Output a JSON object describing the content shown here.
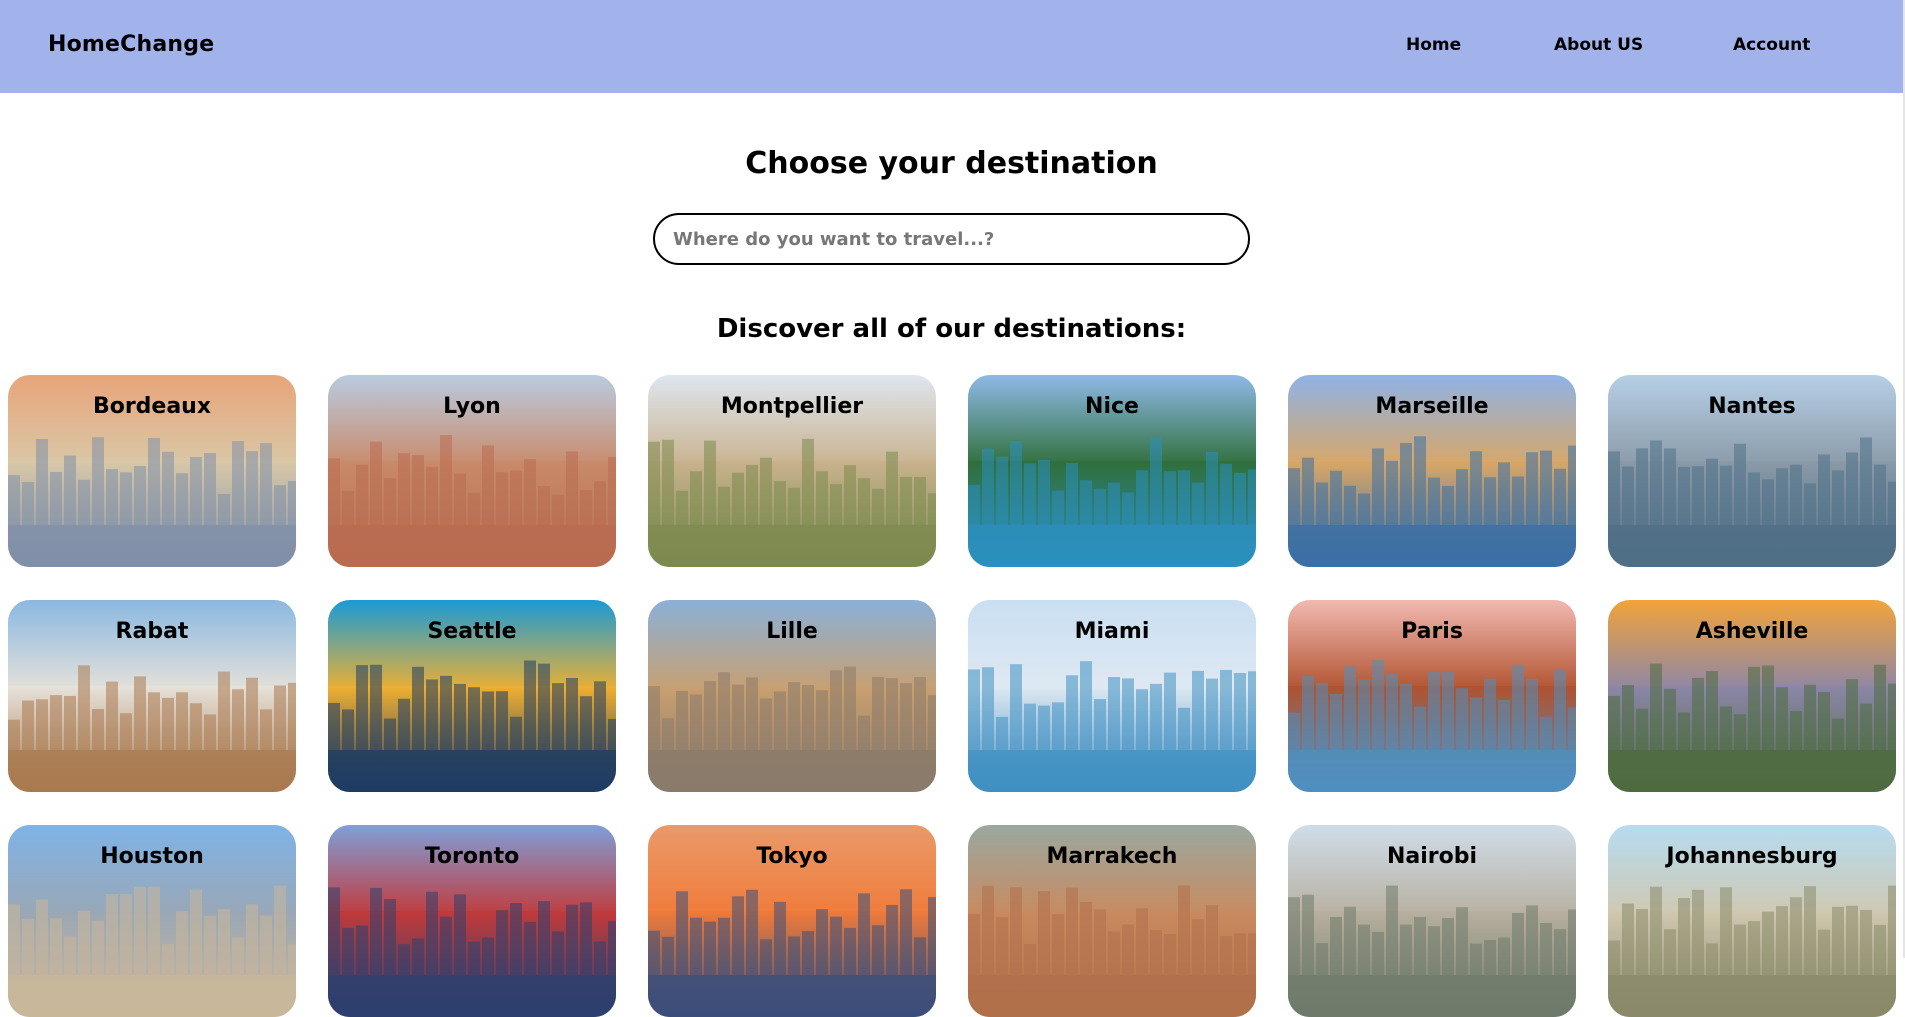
{
  "navbar": {
    "brand": "HomeChange",
    "links": [
      {
        "label": "Home"
      },
      {
        "label": "About US"
      },
      {
        "label": "Account"
      }
    ],
    "color": "#a2b2ea"
  },
  "main": {
    "title": "Choose your destination",
    "search": {
      "placeholder": "Where do you want to travel...?",
      "value": ""
    },
    "section_title": "Discover all of our destinations:"
  },
  "destinations": [
    {
      "name": "Bordeaux",
      "sky": "#e8a57a",
      "ground": "#7f8fa8",
      "accent": "#d9c8a8"
    },
    {
      "name": "Lyon",
      "sky": "#b9cbe0",
      "ground": "#b86b50",
      "accent": "#c98a6a"
    },
    {
      "name": "Montpellier",
      "sky": "#dfe6ef",
      "ground": "#7c8a4f",
      "accent": "#c8b28d"
    },
    {
      "name": "Nice",
      "sky": "#8fb9e8",
      "ground": "#2b8fbf",
      "accent": "#2f6f3a"
    },
    {
      "name": "Marseille",
      "sky": "#8fb2e6",
      "ground": "#3a6fa6",
      "accent": "#d9a766"
    },
    {
      "name": "Nantes",
      "sky": "#b6cfe6",
      "ground": "#4f6f86",
      "accent": "#8a9aa8"
    },
    {
      "name": "Rabat",
      "sky": "#8bb8e0",
      "ground": "#a9794f",
      "accent": "#e6e2da"
    },
    {
      "name": "Seattle",
      "sky": "#1a9ad6",
      "ground": "#1d3b63",
      "accent": "#f0b030"
    },
    {
      "name": "Lille",
      "sky": "#8ab0d8",
      "ground": "#8a7a6a",
      "accent": "#c9a070"
    },
    {
      "name": "Miami",
      "sky": "#c9dff2",
      "ground": "#3f8fc2",
      "accent": "#dfe9f2"
    },
    {
      "name": "Paris",
      "sky": "#f2b9b0",
      "ground": "#4f8fc0",
      "accent": "#b0522f"
    },
    {
      "name": "Asheville",
      "sky": "#f2a33a",
      "ground": "#4d6b3f",
      "accent": "#8c86a8"
    },
    {
      "name": "Houston",
      "sky": "#7fb3e6",
      "ground": "#c9b79a",
      "accent": "#9aa7b5"
    },
    {
      "name": "Toronto",
      "sky": "#7f9fd9",
      "ground": "#2c3f6f",
      "accent": "#c23a3a"
    },
    {
      "name": "Tokyo",
      "sky": "#e99a6a",
      "ground": "#3b4e7a",
      "accent": "#f07b3a"
    },
    {
      "name": "Marrakech",
      "sky": "#9aa89f",
      "ground": "#b0704a",
      "accent": "#c98a5f"
    },
    {
      "name": "Nairobi",
      "sky": "#cfdde9",
      "ground": "#6e7a6a",
      "accent": "#b8b0a0"
    },
    {
      "name": "Johannesburg",
      "sky": "#b6dcf0",
      "ground": "#8a8a6a",
      "accent": "#d0c8b0"
    }
  ]
}
